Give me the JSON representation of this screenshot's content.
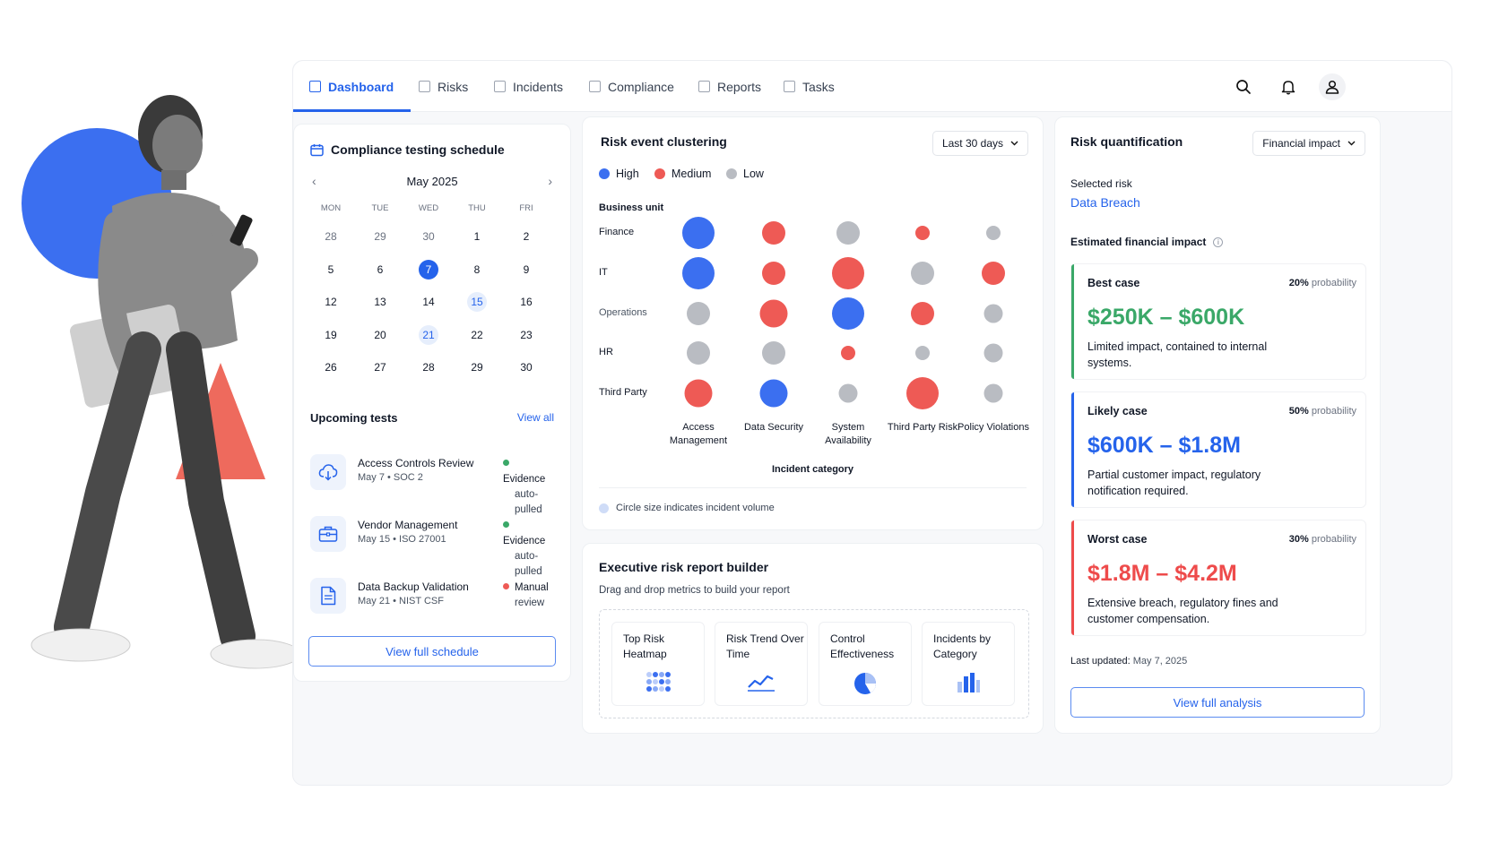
{
  "colors": {
    "accent": "#2563eb",
    "high": "#3b6ff0",
    "medium": "#ee5a55",
    "low": "#b9bcc2",
    "green": "#3aa868",
    "red": "#ee4b4b"
  },
  "nav": {
    "tabs": [
      {
        "label": "Dashboard",
        "active": true
      },
      {
        "label": "Risks"
      },
      {
        "label": "Incidents"
      },
      {
        "label": "Compliance"
      },
      {
        "label": "Reports"
      },
      {
        "label": "Tasks"
      }
    ],
    "icons": [
      "search-icon",
      "bell-icon",
      "user-icon"
    ]
  },
  "schedule": {
    "title": "Compliance testing schedule",
    "month": "May 2025",
    "weekdays": [
      "MON",
      "TUE",
      "WED",
      "THU",
      "FRI"
    ],
    "weeks": [
      [
        "28",
        "29",
        "30",
        "1",
        "2"
      ],
      [
        "5",
        "6",
        "7",
        "8",
        "9"
      ],
      [
        "12",
        "13",
        "14",
        "15",
        "16"
      ],
      [
        "19",
        "20",
        "21",
        "22",
        "23"
      ],
      [
        "26",
        "27",
        "28",
        "29",
        "30"
      ]
    ],
    "selected_day": "7",
    "marked_days": [
      "15",
      "21"
    ],
    "upcoming_title": "Upcoming tests",
    "view_all": "View all",
    "tests": [
      {
        "name": "Access Controls Review",
        "meta": "May 7 • SOC 2",
        "status_1": "Evidence",
        "status_2": "auto-pulled",
        "status_color": "#3aa868",
        "icon": "cloud-download-icon"
      },
      {
        "name": "Vendor Management",
        "meta": "May 15 • ISO 27001",
        "status_1": "Evidence",
        "status_2": "auto-pulled",
        "status_color": "#3aa868",
        "icon": "briefcase-icon"
      },
      {
        "name": "Data Backup Validation",
        "meta": "May 21 • NIST CSF",
        "status_1": "Manual",
        "status_2": "review",
        "status_color": "#ee5a55",
        "icon": "document-icon"
      }
    ],
    "button": "View full schedule"
  },
  "cluster": {
    "title": "Risk event clustering",
    "range": "Last 30 days",
    "legend": [
      {
        "label": "High",
        "color": "#3b6ff0"
      },
      {
        "label": "Medium",
        "color": "#ee5a55"
      },
      {
        "label": "Low",
        "color": "#b9bcc2"
      }
    ],
    "row_head": "Business unit",
    "col_head": "Incident category",
    "rows": [
      "Finance",
      "IT",
      "Operations",
      "HR",
      "Third Party"
    ],
    "cols": [
      "Access Management",
      "Data Security",
      "System Availability",
      "Third Party Risk",
      "Policy Violations"
    ],
    "cells": [
      [
        {
          "level": "High",
          "size": 3
        },
        {
          "level": "Medium",
          "size": 2
        },
        {
          "level": "Low",
          "size": 2
        },
        {
          "level": "Medium",
          "size": 1
        },
        {
          "level": "Low",
          "size": 1
        }
      ],
      [
        {
          "level": "High",
          "size": 3
        },
        {
          "level": "Medium",
          "size": 2
        },
        {
          "level": "Medium",
          "size": 3
        },
        {
          "level": "Low",
          "size": 2
        },
        {
          "level": "Medium",
          "size": 2
        }
      ],
      [
        {
          "level": "Low",
          "size": 2
        },
        {
          "level": "Medium",
          "size": 2.5
        },
        {
          "level": "High",
          "size": 3
        },
        {
          "level": "Medium",
          "size": 2
        },
        {
          "level": "Low",
          "size": 1.5
        }
      ],
      [
        {
          "level": "Low",
          "size": 2
        },
        {
          "level": "Low",
          "size": 2
        },
        {
          "level": "Medium",
          "size": 1
        },
        {
          "level": "Low",
          "size": 1
        },
        {
          "level": "Low",
          "size": 1.5
        }
      ],
      [
        {
          "level": "Medium",
          "size": 2.5
        },
        {
          "level": "High",
          "size": 2.5
        },
        {
          "level": "Low",
          "size": 1.5
        },
        {
          "level": "Medium",
          "size": 3
        },
        {
          "level": "Low",
          "size": 1.5
        }
      ]
    ],
    "note": "Circle size indicates incident volume"
  },
  "builder": {
    "title": "Executive risk report builder",
    "subtitle": "Drag and drop metrics to build your report",
    "metrics": [
      {
        "label": "Top Risk Heatmap",
        "icon": "heatmap-icon"
      },
      {
        "label": "Risk Trend Over Time",
        "icon": "trend-line-icon"
      },
      {
        "label": "Control Effectiveness",
        "icon": "pie-chart-icon"
      },
      {
        "label": "Incidents by Category",
        "icon": "bar-chart-icon"
      }
    ]
  },
  "quant": {
    "title": "Risk quantification",
    "dropdown": "Financial impact",
    "selected_label": "Selected risk",
    "selected_value": "Data Breach",
    "impact_label": "Estimated financial impact",
    "scenarios": [
      {
        "name": "Best case",
        "prob": "20%",
        "prob_word": "probability",
        "range": "$250K – $600K",
        "desc": "Limited impact, contained to internal systems.",
        "color": "#3aa868"
      },
      {
        "name": "Likely case",
        "prob": "50%",
        "prob_word": "probability",
        "range": "$600K – $1.8M",
        "desc": "Partial customer impact, regulatory notification required.",
        "color": "#2563eb"
      },
      {
        "name": "Worst case",
        "prob": "30%",
        "prob_word": "probability",
        "range": "$1.8M – $4.2M",
        "desc": "Extensive breach, regulatory fines and customer compensation.",
        "color": "#ee4b4b"
      }
    ],
    "updated_label": "Last updated:",
    "updated_value": "May 7, 2025",
    "button": "View full analysis"
  }
}
